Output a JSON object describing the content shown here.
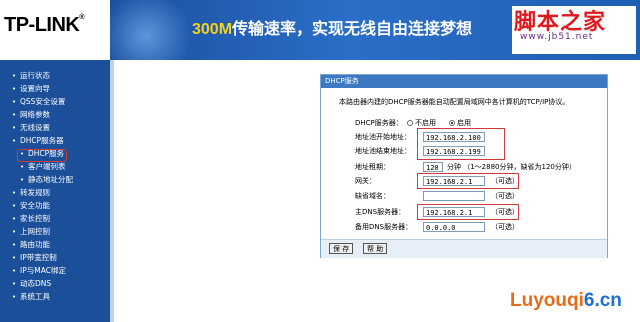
{
  "header": {
    "logo": "TP-LINK",
    "logo_mark": "®",
    "slogan_num": "300M",
    "slogan_text": "传输速率，实现无线自由连接梦想",
    "watermark_title": "脚本之家",
    "watermark_url": "www.jb51.net"
  },
  "sidebar": {
    "items": [
      {
        "label": "运行状态"
      },
      {
        "label": "设置向导"
      },
      {
        "label": "QSS安全设置"
      },
      {
        "label": "网络参数"
      },
      {
        "label": "无线设置"
      },
      {
        "label": "DHCP服务器"
      },
      {
        "label": "DHCP服务",
        "sub": true,
        "selected": true
      },
      {
        "label": "客户端列表",
        "sub": true
      },
      {
        "label": "静态地址分配",
        "sub": true
      },
      {
        "label": "转发规则"
      },
      {
        "label": "安全功能"
      },
      {
        "label": "家长控制"
      },
      {
        "label": "上网控制"
      },
      {
        "label": "路由功能"
      },
      {
        "label": "IP带宽控制"
      },
      {
        "label": "IP与MAC绑定"
      },
      {
        "label": "动态DNS"
      },
      {
        "label": "系统工具"
      }
    ]
  },
  "panel": {
    "title": "DHCP服务",
    "description": "本路由器内建的DHCP服务器能自动配置局域网中各计算机的TCP/IP协议。",
    "dhcp_server": {
      "label": "DHCP服务器：",
      "off": "不启用",
      "on": "启用",
      "selected": "on"
    },
    "start_ip": {
      "label": "地址池开始地址：",
      "value": "192.168.2.100"
    },
    "end_ip": {
      "label": "地址池结束地址：",
      "value": "192.168.2.199"
    },
    "lease": {
      "label": "地址租期：",
      "value": "120",
      "hint": "分钟 （1～2880分钟，缺省为120分钟）"
    },
    "gateway": {
      "label": "网关：",
      "value": "192.168.2.1",
      "hint": "（可选）"
    },
    "domain": {
      "label": "缺省域名：",
      "value": "",
      "hint": "（可选）"
    },
    "dns_primary": {
      "label": "主DNS服务器：",
      "value": "192.168.2.1",
      "hint": "（可选）"
    },
    "dns_secondary": {
      "label": "备用DNS服务器：",
      "value": "0.0.0.0",
      "hint": "（可选）"
    },
    "buttons": {
      "save": "保 存",
      "help": "帮 助"
    }
  },
  "watermark_bottom": {
    "part1": "Luyouqi",
    "part2": "6.cn"
  }
}
